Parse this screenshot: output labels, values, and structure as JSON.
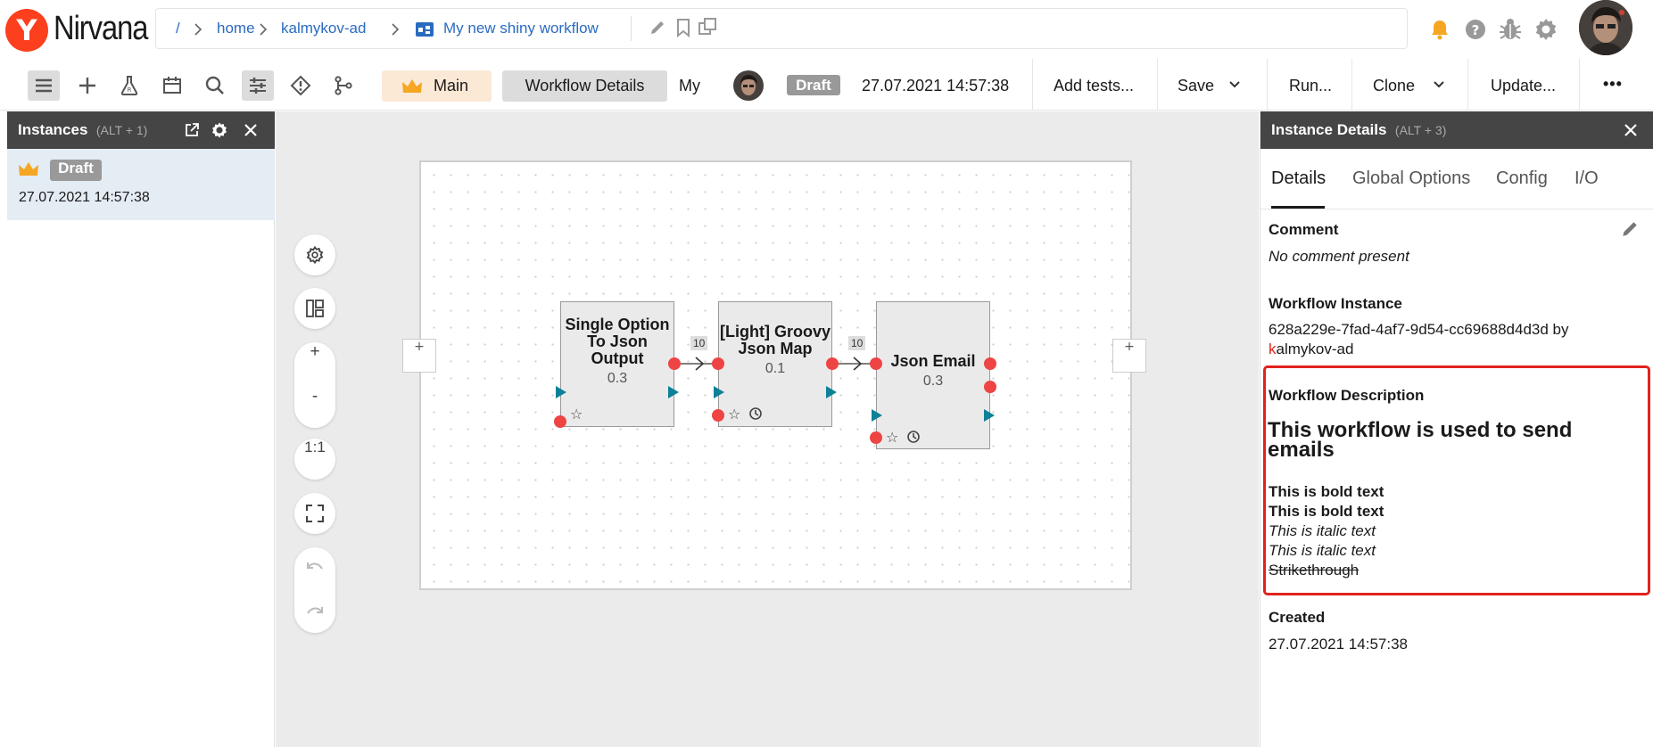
{
  "app": {
    "logo_letter": "Y",
    "brand": "Nirvana"
  },
  "breadcrumb": {
    "root": "/",
    "items": [
      "home",
      "kalmykov-ad"
    ],
    "workflow_name": "My new shiny workflow"
  },
  "toolbar": {
    "main_label": "Main",
    "workflow_details_label": "Workflow Details",
    "my_label": "My",
    "draft_label": "Draft",
    "timestamp": "27.07.2021 14:57:38",
    "add_tests_label": "Add tests...",
    "save_label": "Save",
    "run_label": "Run...",
    "clone_label": "Clone",
    "update_label": "Update...",
    "more_label": "•••"
  },
  "instances_panel": {
    "title": "Instances",
    "shortcut": "(ALT + 1)",
    "instance": {
      "status": "Draft",
      "timestamp": "27.07.2021 14:57:38"
    }
  },
  "canvas": {
    "zoom_in": "+",
    "zoom_out": "-",
    "actual_size": "1:1",
    "add_left": "+",
    "add_right": "+",
    "blocks": [
      {
        "name": "Single Option To Json Output",
        "version": "0.3"
      },
      {
        "name": "[Light] Groovy Json Map",
        "version": "0.1"
      },
      {
        "name": "Json Email",
        "version": "0.3"
      }
    ],
    "edge_labels": [
      "10",
      "10"
    ]
  },
  "details_panel": {
    "title": "Instance Details",
    "shortcut": "(ALT + 3)",
    "tabs": [
      "Details",
      "Global Options",
      "Config",
      "I/O"
    ],
    "comment_label": "Comment",
    "comment_value": "No comment present",
    "instance_label": "Workflow Instance",
    "instance_id": "628a229e-7fad-4af7-9d54-cc69688d4d3d by",
    "instance_owner_first": "k",
    "instance_owner_rest": "almykov-ad",
    "description_label": "Workflow Description",
    "description_heading": "This workflow is used to send emails",
    "description_lines": [
      "This is bold text",
      "This is bold text",
      "This is italic text",
      "This is italic text",
      "Strikethrough"
    ],
    "created_label": "Created",
    "created_value": "27.07.2021 14:57:38"
  },
  "colors": {
    "accent_red": "#fc3f1d",
    "link": "#2a6bc0",
    "highlight_box": "#e0231d",
    "port": "#ef4444",
    "port_triangle": "#0d8198",
    "crown": "#f5a623"
  }
}
